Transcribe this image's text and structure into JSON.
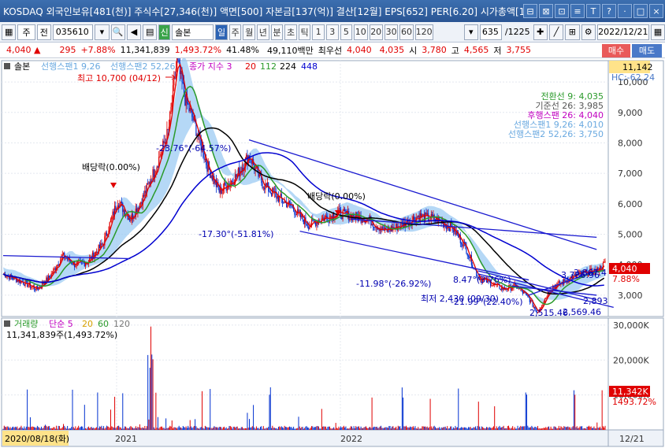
{
  "window": {
    "title": "KOSDAQ 외국인보유[481(천)] 주식수[27,346(천)] 액면[500] 자본금[137(억)] 결산[12월] EPS[652] PER[6.20] 시가총액[1,",
    "controls": [
      "⊟",
      "⊠",
      "⊡",
      "≡",
      "T",
      "?",
      "·",
      "□",
      "×"
    ]
  },
  "toolbar": {
    "type_select": "주",
    "prefix_label": "전",
    "code_value": "035610",
    "stock_badge": "신",
    "stock_name": "솔본",
    "periods": [
      "일",
      "주",
      "월",
      "년",
      "분",
      "초",
      "틱"
    ],
    "intervals": [
      "1",
      "3",
      "5",
      "10",
      "20",
      "30",
      "60",
      "120"
    ],
    "count_value": "635",
    "count_total": "/1225",
    "date_value": "2022/12/21"
  },
  "pricebar": {
    "price": "4,040",
    "change": "295",
    "change_pct": "+7.88%",
    "volume": "11,341,839",
    "volume_pct": "1,493.72%",
    "turnover": "41.48%",
    "amount": "49,110백만",
    "priority_label": "최우선",
    "bid1": "4,040",
    "ask1": "4,035",
    "open_label": "시",
    "open": "3,780",
    "high_label": "고",
    "high": "4,565",
    "low_label": "저",
    "low": "3,755",
    "buy_label": "매수",
    "sell_label": "매도"
  },
  "chart_data": [
    {
      "type": "candlestick",
      "title": "솔본",
      "legend": [
        "선행스팬1 9,26",
        "선행스팬2 52,26",
        "종가 지수 3",
        "20",
        "112",
        "224",
        "448"
      ],
      "y_ticks": [
        "10,000",
        "9,000",
        "8,000",
        "7,000",
        "6,000",
        "5,000",
        "4,000",
        "3,000"
      ],
      "ylim": [
        2300,
        10700
      ],
      "x_ticks": [
        "2021",
        "2022"
      ],
      "last_price_label": "4,040",
      "last_change_label": "7.88%",
      "top_value_label": "11,142",
      "top_indicator_label": "HC:-62.24",
      "annotations": {
        "high": "최고 10,700 (04/12)",
        "dividend1": "배당락(0.00%)",
        "dividend2": "배당락(0.00%)",
        "trend1": "-23.76°(-64.57%)",
        "trend2": "-17.30°(-51.81%)",
        "trend3": "-11.98°(-26.92%)",
        "trend4": "8.47°(3.76%)",
        "trend5": "-21.99°(22.40%)",
        "low": "최저 2,430 (09/30)",
        "line_val1": "2,893",
        "line_val2": "2,569.46",
        "line_val3": "2,515.46",
        "line_val4": "3,786.96",
        "line_val5": "3,867.4"
      },
      "ichimoku_box": {
        "conversion": "전환선 9: 4,035",
        "base": "기준선 26: 3,985",
        "lagging": "후행스팬 26: 4,040",
        "span1": "선행스팬1 9,26: 4,010",
        "span2": "선행스팬2 52,26: 3,750"
      }
    },
    {
      "type": "bar",
      "title": "거래량",
      "legend": [
        "단순 5",
        "20",
        "60",
        "120"
      ],
      "summary": "11,341,839주(1,493.72%)",
      "y_ticks": [
        "30,000K",
        "20,000K",
        "10,000K"
      ],
      "ylim": [
        0,
        32000
      ],
      "last_volume_label": "11,342K",
      "last_pct_label": "1493.72%"
    }
  ],
  "xaxis": {
    "start_label": "2020/08/18(화)",
    "right_label": "12/21"
  },
  "colors": {
    "titlebar": "#2a5594",
    "up": "#e00000",
    "down": "#0030d0",
    "ma5": "#e00000",
    "ma20": "#2a9a2a",
    "ma112": "#000000",
    "ma224": "#0000d0",
    "cloud": "#9ccbf3"
  }
}
